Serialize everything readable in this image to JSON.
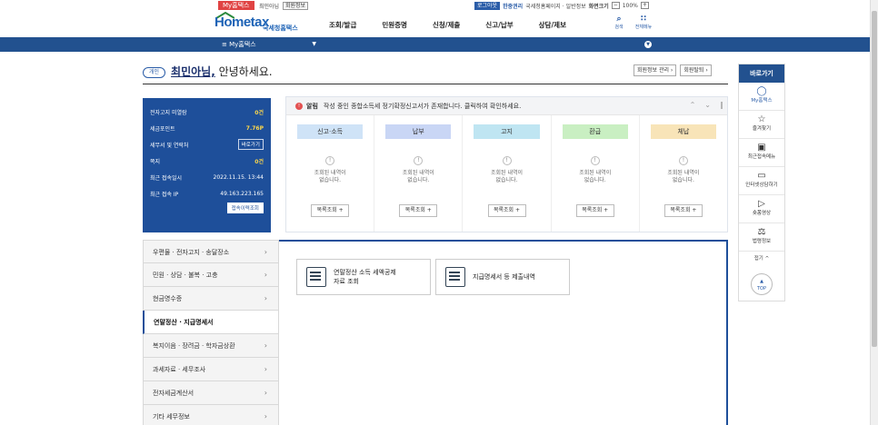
{
  "topbar": {
    "mytax_badge": "My홈택스",
    "user": "최민아님",
    "member_info": "회원정보",
    "logout": "로그아웃",
    "simplified": "한중권리",
    "links": "국세청홈페이지 · 일반정보",
    "zoom_label": "화면크기",
    "zoom_minus": "−",
    "zoom_value": "100%",
    "zoom_plus": "+"
  },
  "header": {
    "logo_main": "Hometax",
    "logo_sub": "국세청홈택스",
    "nav": [
      "조회/발급",
      "민원증명",
      "신청/제출",
      "신고/납부",
      "상담/제보"
    ],
    "search_label": "검색",
    "allmenu_label": "전체메뉴"
  },
  "bluebar": {
    "menu_title": "≡  My홈택스"
  },
  "greeting": {
    "tag": "개인",
    "name": "최민아님,",
    "text": " 안녕하세요."
  },
  "account_buttons": [
    "회원정보 관리 ›",
    "회원탈퇴 ›"
  ],
  "info": {
    "rows": [
      {
        "label": "전자고지 미열람",
        "value": "0건"
      },
      {
        "label": "세금포인트",
        "value": "7.76P"
      },
      {
        "label": "세무서 및 연락처",
        "button": "바로가기"
      },
      {
        "label": "쪽지",
        "value": "0건"
      },
      {
        "label": "최근 접속일시",
        "value": "2022.11.15.  13:44"
      },
      {
        "label": "최근 접속 IP",
        "value": "49.163.223.165"
      }
    ],
    "history_button": "접속이력조회"
  },
  "alert": {
    "label": "알림",
    "text": "작성 중인 종합소득세 정기확정신고서가 존재합니다. 클릭하여 확인하세요."
  },
  "columns": [
    {
      "title": "신고·소득",
      "color": "#cfe3f7",
      "empty": "조회된 내역이\n없습니다.",
      "button": "목록조회 +"
    },
    {
      "title": "납부",
      "color": "#c9d6f5",
      "empty": "조회된 내역이\n없습니다.",
      "button": "목록조회 +"
    },
    {
      "title": "고지",
      "color": "#bfe5f2",
      "empty": "조회된 내역이\n없습니다.",
      "button": "목록조회 +"
    },
    {
      "title": "환급",
      "color": "#c9efc2",
      "empty": "조회된 내역이\n없습니다.",
      "button": "목록조회 +"
    },
    {
      "title": "체납",
      "color": "#f8e4b8",
      "empty": "조회된 내역이\n없습니다.",
      "button": "목록조회 +"
    }
  ],
  "left_menu": [
    "우편물 · 전자고지 · 송달장소",
    "민원 · 상담 · 불복 · 고충",
    "현금영수증",
    "연말정산 · 지급명세서",
    "복지이음 · 장려금 · 학자금상환",
    "과세자료 · 세무조사",
    "전자세금계산서",
    "기타 세무정보"
  ],
  "cards": [
    {
      "line1": "연말정산 소득 세액공제",
      "line2": "자료 조회"
    },
    {
      "line1": "지급명세서 등 제출내역",
      "line2": ""
    }
  ],
  "right_sidebar": {
    "title": "바로가기",
    "items": [
      "My홈택스",
      "즐겨찾기",
      "최근접속메뉴",
      "인터넷상담하기",
      "숏폼영상",
      "법령정보"
    ],
    "fold": "접기 ^",
    "top": "TOP"
  }
}
